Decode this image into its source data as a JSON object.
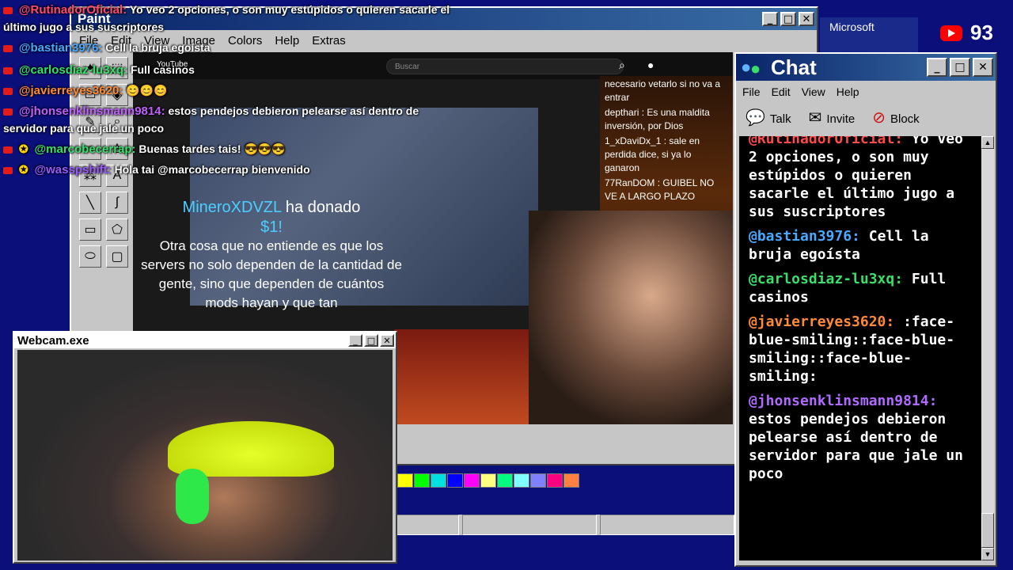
{
  "paint": {
    "title": "Paint",
    "menu": [
      "File",
      "Edit",
      "View",
      "Image",
      "Colors",
      "Help",
      "Extras"
    ],
    "palette": [
      "#ffff00",
      "#00ff00",
      "#00e0e0",
      "#0000ff",
      "#ff00ff",
      "#ffff80",
      "#00ff80",
      "#80ffff",
      "#8080ff",
      "#ff0080",
      "#ff8040"
    ],
    "buttons": {
      "minimize": "_",
      "maximize": "□",
      "close": "✕"
    }
  },
  "stream": {
    "search_placeholder": "Buscar",
    "yt_label": "YouTube",
    "donation": {
      "name": "MineroXDVZL",
      "action": "ha donado",
      "amount": "$1!",
      "message": "Otra cosa que no entiende es que los servers no solo dependen de la cantidad de gente, sino que dependen de cuántos mods hayan y que tan"
    },
    "nested_chat": [
      "necesario vetarlo si no va a entrar",
      "depthari : Es una maldita inversión, por Dios",
      "1_xDaviDx_1 : sale en perdida dice, si ya lo ganaron",
      "77RanDOM : GUIBEL NO VE A LARGO PLAZO"
    ]
  },
  "chat_window": {
    "title": "Chat",
    "menu": [
      "File",
      "Edit",
      "View",
      "Help"
    ],
    "tools": [
      {
        "label": "Talk",
        "icon": "talk-icon"
      },
      {
        "label": "Invite",
        "icon": "invite-icon"
      },
      {
        "label": "Block",
        "icon": "block-icon"
      }
    ],
    "messages": [
      {
        "user": "@RutinadorOficial:",
        "text": "Yo veo 2 opciones, o son muy estúpidos o quieren sacarle el último jugo a sus suscriptores",
        "color": "#ff4a4a"
      },
      {
        "user": "@bastian3976:",
        "text": "Cell la bruja egoísta",
        "color": "#4aa8ff"
      },
      {
        "user": "@carlosdiaz-lu3xq:",
        "text": "Full casinos",
        "color": "#3adf6a"
      },
      {
        "user": "@javierreyes3620:",
        "text": ":face-blue-smiling::face-blue-smiling::face-blue-smiling:",
        "color": "#ff8a3a"
      },
      {
        "user": "@jhonsenklinsmann9814:",
        "text": "estos pendejos debieron pelearse así dentro de servidor para que jale un poco",
        "color": "#b06aff"
      }
    ]
  },
  "webcam": {
    "title": "Webcam.exe"
  },
  "overlay_chat": [
    {
      "user": "@RutinadorOficial:",
      "text": "Yo veo 2 opciones, o son muy estúpidos o quieren sacarle el",
      "color": "#ff4a6a"
    },
    {
      "user": "",
      "text": "último jugo a sus suscriptores",
      "color": "#ffffff"
    },
    {
      "user": "@bastian3976:",
      "text": "Cell la bruja egoísta",
      "color": "#4aa8ff"
    },
    {
      "user": "@carlosdiaz-lu3xq:",
      "text": "Full casinos",
      "color": "#3adf6a"
    },
    {
      "user": "@javierreyes3620:",
      "text": "😊😊😊",
      "color": "#ff8a3a"
    },
    {
      "user": "@jhonsenklinsmann9814:",
      "text": "estos pendejos debieron pelearse así dentro de",
      "color": "#c060ff"
    },
    {
      "user": "",
      "text": "servidor para que jale un poco",
      "color": "#ffffff"
    },
    {
      "user": "@marcobecerrap:",
      "text": "Buenas tardes tais! 😎😎😎",
      "color": "#3adf6a"
    },
    {
      "user": "@wasspshift:",
      "text": "Hola tai @marcobecerrap bienvenido",
      "color": "#9a5aff"
    }
  ],
  "viewer_count": "93",
  "corner_brand": "Microsoft"
}
